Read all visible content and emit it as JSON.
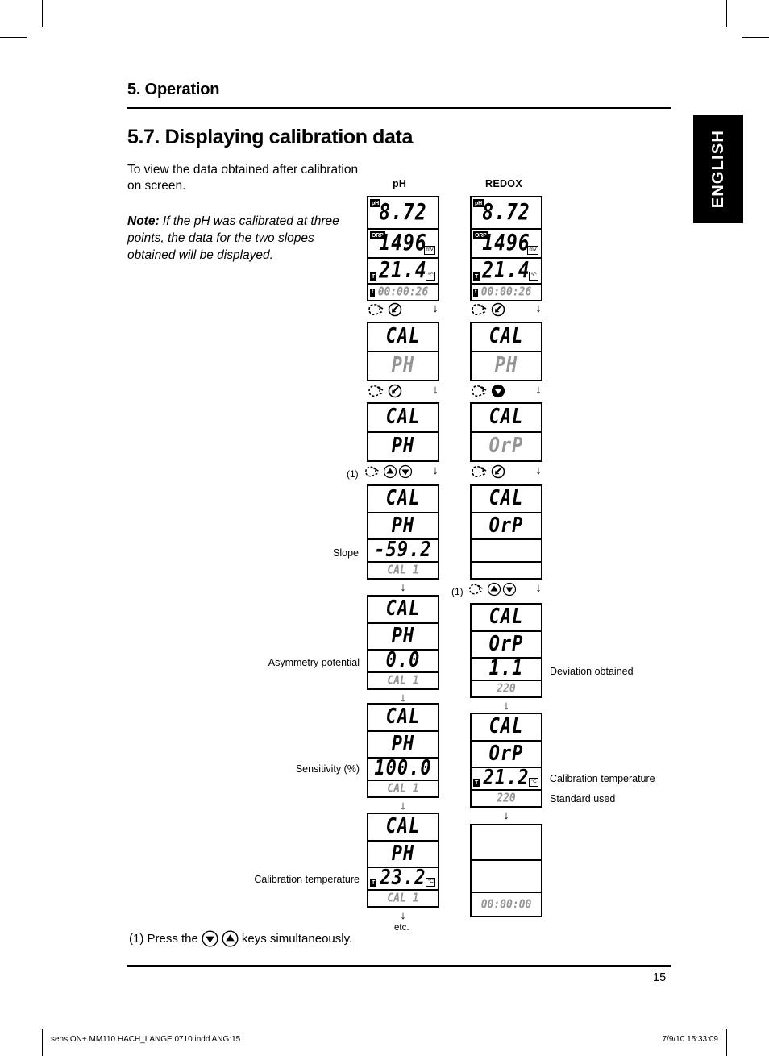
{
  "page": {
    "chapter": "5. Operation",
    "section_title": "5.7. Displaying calibration data",
    "intro": "To view the data obtained after calibration on screen.",
    "note_label": "Note:",
    "note_text": " If the pH was calibrated at three points, the data for the two slopes obtained will be displayed.",
    "language_tab": "ENGLISH",
    "page_number": "15",
    "footnote": "(1) Press the",
    "footnote_tail": "keys simultaneously.",
    "etc_label": "etc."
  },
  "columns": {
    "left_heading": "pH",
    "right_heading": "REDOX"
  },
  "annotations": {
    "slope": "Slope",
    "asymmetry": "Asymmetry potential",
    "sensitivity": "Sensitivity (%)",
    "calibration_temperature_left": "Calibration temperature",
    "deviation": "Deviation obtained",
    "calibration_temperature_right": "Calibration temperature",
    "standard_used": "Standard used",
    "marker": "(1)"
  },
  "units": {
    "mv": "mV",
    "celsius": "°C"
  },
  "tags": {
    "ph": "pH",
    "orp": "ORP",
    "temp": "T",
    "timer": "t"
  },
  "lcd": {
    "ph_measure": {
      "ph_value": "8.72",
      "orp_value": "1496",
      "temp_value": "21.4",
      "timer_value": "00:00:26"
    },
    "redox_measure": {
      "ph_value": "8.72",
      "orp_value": "1496",
      "temp_value": "21.4",
      "timer_value": "00:00:26"
    },
    "ph_cal_blink": {
      "line1": "CAL",
      "line2": "PH"
    },
    "ph_cal_solid": {
      "line1": "CAL",
      "line2": "PH"
    },
    "ph_slope": {
      "line1": "CAL",
      "line2": "PH",
      "line3": "-59.2",
      "line4": "CAL 1"
    },
    "ph_asym": {
      "line1": "CAL",
      "line2": "PH",
      "line3": "0.0",
      "line4": "CAL 1"
    },
    "ph_sens": {
      "line1": "CAL",
      "line2": "PH",
      "line3": "100.0",
      "line4": "CAL 1"
    },
    "ph_caltemp": {
      "line1": "CAL",
      "line2": "PH",
      "line3": "23.2",
      "line4": "CAL 1"
    },
    "rx_cal_blink": {
      "line1": "CAL",
      "line2": "PH"
    },
    "rx_cal_orp": {
      "line1": "CAL",
      "line2": "OrP"
    },
    "rx_orp_solid": {
      "line1": "CAL",
      "line2": "OrP",
      "line3": "",
      "line4": ""
    },
    "rx_deviation": {
      "line1": "CAL",
      "line2": "OrP",
      "line3": "1.1",
      "line4": "220"
    },
    "rx_caltemp": {
      "line1": "CAL",
      "line2": "OrP",
      "line3": "21.2",
      "line4": "220"
    },
    "rx_final": {
      "line1": "",
      "line2": "",
      "line3": "00:00:00"
    }
  },
  "imprint": {
    "left": "sensION+ MM110 HACH_LANGE 0710.indd   ANG:15",
    "right": "7/9/10   15:33:09"
  },
  "colors": {
    "ink": "#000000",
    "blink_grey": "#949494",
    "paper": "#ffffff"
  }
}
